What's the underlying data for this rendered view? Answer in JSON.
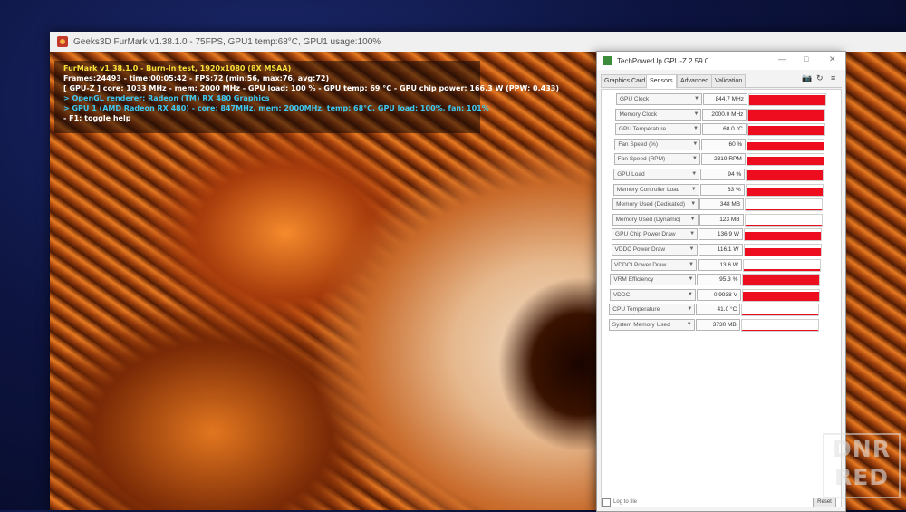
{
  "furmark": {
    "window_title": "Geeks3D FurMark v1.38.1.0 - 75FPS, GPU1 temp:68°C, GPU1 usage:100%",
    "overlay_lines": [
      "FurMark v1.38.1.0 - Burn-in test, 1920x1080 (8X MSAA)",
      "Frames:24493 - time:00:05:42 - FPS:72 (min:56, max:76, avg:72)",
      "[ GPU-Z ] core: 1033 MHz - mem: 2000 MHz - GPU load: 100 % - GPU temp: 69 °C - GPU chip power: 166.3 W (PPW: 0.433)",
      "> OpenGL renderer: Radeon (TM) RX 480 Graphics",
      "> GPU 1 (AMD Radeon RX 480) - core: 847MHz, mem: 2000MHz, temp: 68°C, GPU load: 100%, fan: 101%",
      "- F1: toggle help"
    ]
  },
  "gpuz": {
    "title": "TechPowerUp GPU-Z 2.59.0",
    "window_controls": [
      "—",
      "□",
      "✕"
    ],
    "toolbar_icons": [
      "📷",
      "↻",
      "≡"
    ],
    "tabs": [
      "Graphics Card",
      "Sensors",
      "Advanced",
      "Validation"
    ],
    "active_tab": "Sensors",
    "sensors": [
      {
        "label": "GPU Clock",
        "value": "844.7 MHz",
        "level": 0.95
      },
      {
        "label": "Memory Clock",
        "value": "2000.0 MHz",
        "level": 0.95
      },
      {
        "label": "GPU Temperature",
        "value": "68.0 °C",
        "level": 0.85
      },
      {
        "label": "Fan Speed (%)",
        "value": "60 %",
        "level": 0.7
      },
      {
        "label": "Fan Speed (RPM)",
        "value": "2319 RPM",
        "level": 0.75
      },
      {
        "label": "GPU Load",
        "value": "94 %",
        "level": 0.94
      },
      {
        "label": "Memory Controller Load",
        "value": "63 %",
        "level": 0.63
      },
      {
        "label": "Memory Used (Dedicated)",
        "value": "348 MB",
        "level": 0.05
      },
      {
        "label": "Memory Used (Dynamic)",
        "value": "123 MB",
        "level": 0.03
      },
      {
        "label": "GPU Chip Power Draw",
        "value": "136.9 W",
        "level": 0.75
      },
      {
        "label": "VDDC Power Draw",
        "value": "116.1 W",
        "level": 0.7
      },
      {
        "label": "VDDCI Power Draw",
        "value": "13.6 W",
        "level": 0.1
      },
      {
        "label": "VRM Efficiency",
        "value": "95.3 %",
        "level": 0.95
      },
      {
        "label": "VDDC",
        "value": "0.9938 V",
        "level": 0.8
      },
      {
        "label": "CPU Temperature",
        "value": "41.0 °C",
        "level": 0.1
      },
      {
        "label": "System Memory Used",
        "value": "3730 MB",
        "level": 0.1
      }
    ],
    "log_label": "Log to file",
    "reset_label": "Reset",
    "accent_color": "#ee0d1e"
  },
  "watermark": {
    "line1": "DNR",
    "line2": "RED"
  }
}
